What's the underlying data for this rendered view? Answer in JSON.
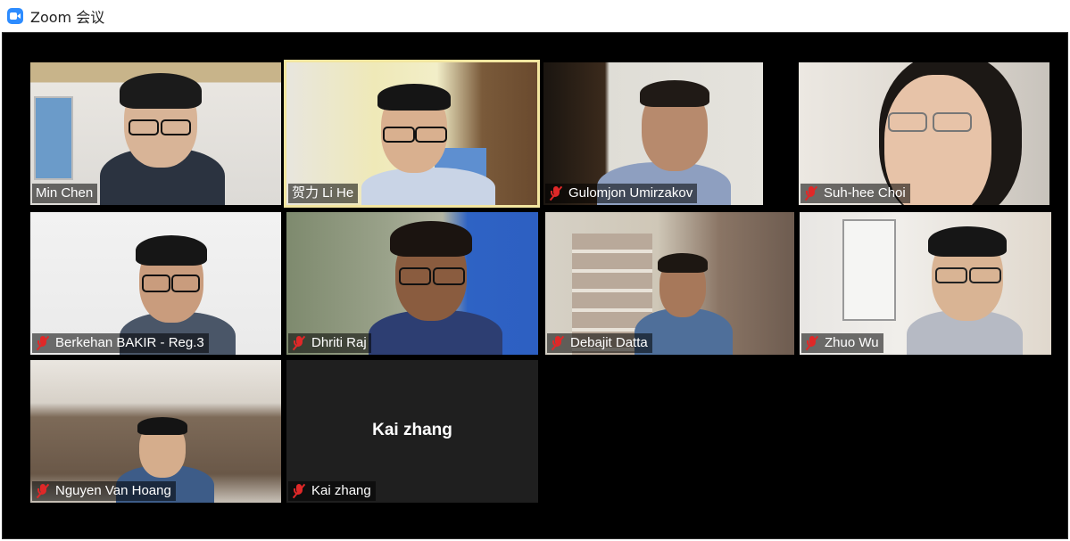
{
  "window": {
    "title": "Zoom 会议",
    "icon": "zoom-camera-icon",
    "accent": "#2D8CFF"
  },
  "participants": [
    {
      "name": "Min Chen",
      "muted": false,
      "active_speaker": false
    },
    {
      "name": "贺力 Li He",
      "muted": false,
      "active_speaker": true
    },
    {
      "name": "Gulomjon Umirzakov",
      "muted": true,
      "active_speaker": false
    },
    {
      "name": "Suh-hee Choi",
      "muted": true,
      "active_speaker": false
    },
    {
      "name": "Berkehan BAKIR - Reg.3",
      "muted": true,
      "active_speaker": false
    },
    {
      "name": "Dhriti Raj",
      "muted": true,
      "active_speaker": false
    },
    {
      "name": "Debajit Datta",
      "muted": true,
      "active_speaker": false
    },
    {
      "name": "Zhuo Wu",
      "muted": true,
      "active_speaker": false
    },
    {
      "name": "Nguyen Van Hoang",
      "muted": true,
      "active_speaker": false
    },
    {
      "name": "Kai zhang",
      "muted": true,
      "active_speaker": false,
      "video_off": true
    }
  ],
  "colors": {
    "muted_icon": "#e02828",
    "active_border": "#f3e6a0",
    "tile_empty": "#1f1f1f"
  }
}
